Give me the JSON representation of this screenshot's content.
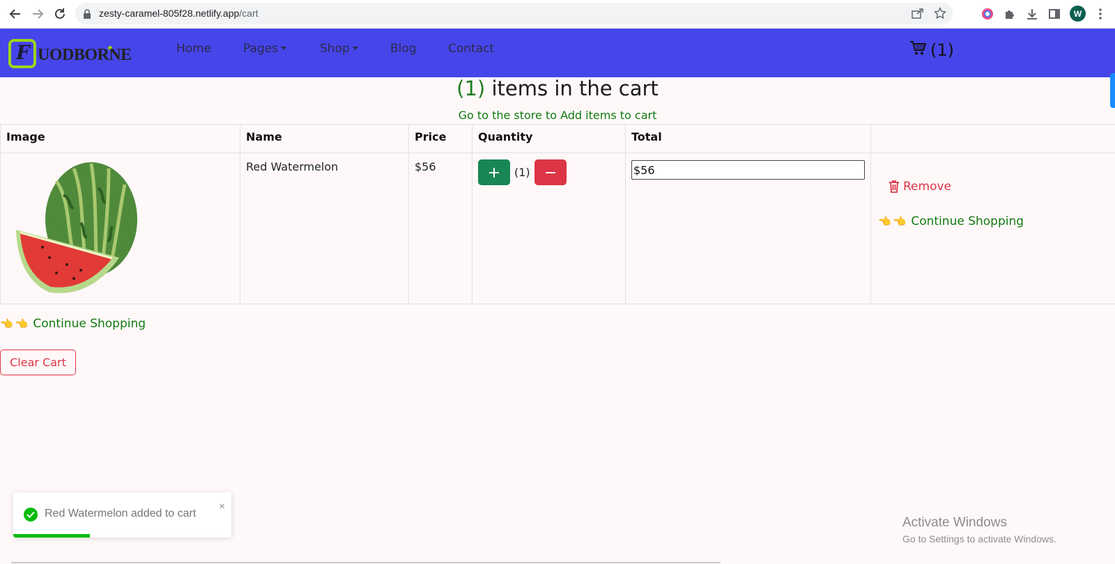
{
  "browser": {
    "url_host": "zesty-caramel-805f28.netlify.app",
    "url_path": "/cart",
    "avatar_letter": "W"
  },
  "navbar": {
    "logo_text": "UODBORNE",
    "logo_letter": "F",
    "links": [
      "Home",
      "Pages",
      "Shop",
      "Blog",
      "Contact"
    ],
    "cart_count": "(1)",
    "bg_color": "#4645ea"
  },
  "cart": {
    "heading_count": "(1)",
    "heading_text": "items in the cart",
    "store_link": "Go to the store to Add items to cart",
    "columns": [
      "Image",
      "Name",
      "Price",
      "Quantity",
      "Total"
    ],
    "items": [
      {
        "name": "Red Watermelon",
        "price": "$56",
        "quantity": "(1)",
        "total": "$56",
        "remove_label": "Remove",
        "continue_label": "Continue Shopping"
      }
    ],
    "continue_label": "Continue Shopping",
    "clear_label": "Clear Cart"
  },
  "toast": {
    "message": "Red Watermelon added to cart",
    "close": "×",
    "progress": 0.35,
    "color": "#07bc0c"
  },
  "windows": {
    "title": "Activate Windows",
    "subtitle": "Go to Settings to activate Windows."
  }
}
